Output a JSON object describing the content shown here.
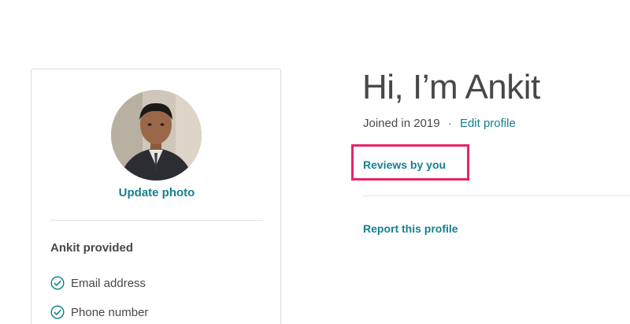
{
  "sidebar": {
    "update_photo_label": "Update photo",
    "provided_title": "Ankit provided",
    "verified_items": [
      {
        "label": "Email address",
        "icon": "check-circle-icon"
      },
      {
        "label": "Phone number",
        "icon": "check-circle-icon"
      }
    ]
  },
  "main": {
    "greeting": "Hi, I’m Ankit",
    "joined_text": "Joined in 2019",
    "separator": "·",
    "edit_profile_label": "Edit profile",
    "reviews_label": "Reviews by you",
    "report_label": "Report this profile"
  },
  "colors": {
    "accent": "#16808f",
    "highlight": "#e8246b",
    "text": "#484848",
    "divider": "#e4e4e4"
  }
}
